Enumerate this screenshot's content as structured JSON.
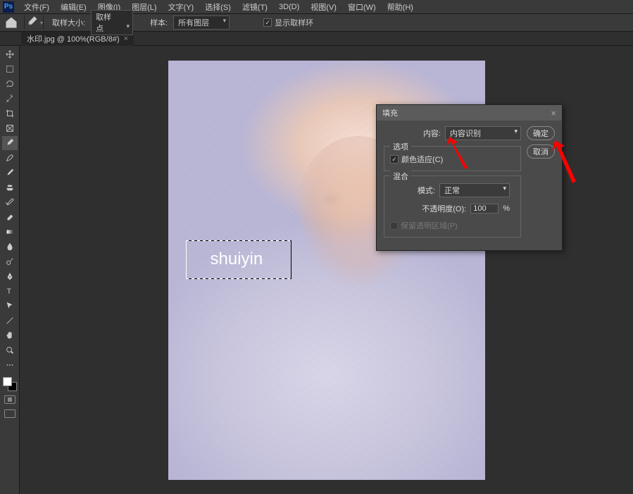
{
  "menubar": {
    "items": [
      "文件(F)",
      "编辑(E)",
      "图像(I)",
      "图层(L)",
      "文字(Y)",
      "选择(S)",
      "滤镜(T)",
      "3D(D)",
      "视图(V)",
      "窗口(W)",
      "帮助(H)"
    ]
  },
  "optionsbar": {
    "sample_size_label": "取样大小:",
    "sample_size_value": "取样点",
    "sample_label": "样本:",
    "sample_value": "所有图层",
    "show_ring": "显示取样环"
  },
  "tab": {
    "title": "水印.jpg @ 100%(RGB/8#)",
    "close": "×"
  },
  "canvas": {
    "watermark_text": "shuiyin"
  },
  "dialog": {
    "title": "填充",
    "close": "×",
    "content_label": "内容:",
    "content_value": "内容识别",
    "options_title": "选项",
    "color_adapt": "颜色适应(C)",
    "blend_title": "混合",
    "mode_label": "模式:",
    "mode_value": "正常",
    "opacity_label": "不透明度(O):",
    "opacity_value": "100",
    "opacity_unit": "%",
    "preserve_trans": "保留透明区域(P)",
    "ok": "确定",
    "cancel": "取消"
  },
  "tools": {
    "names": [
      "move",
      "marquee",
      "lasso",
      "quick-select",
      "crop",
      "frame",
      "eyedropper",
      "healing",
      "brush",
      "clone",
      "history-brush",
      "eraser",
      "gradient",
      "blur",
      "dodge",
      "pen",
      "type",
      "path-select",
      "line",
      "hand",
      "zoom",
      "edit-toolbar"
    ]
  }
}
